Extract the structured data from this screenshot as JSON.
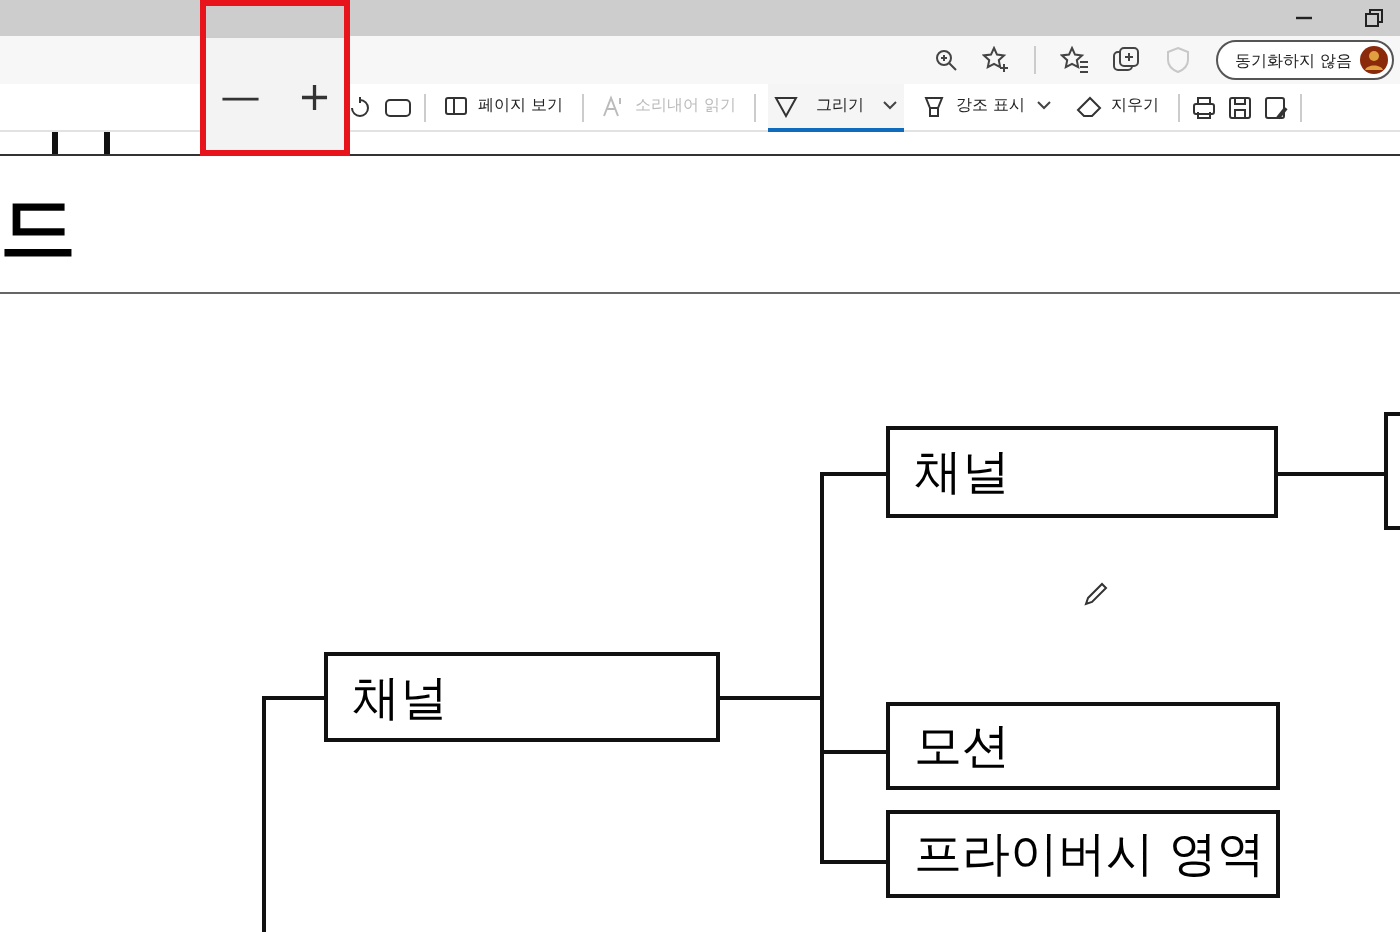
{
  "profile_button": {
    "label": "동기화하지 않음"
  },
  "zoom_flyout": {
    "buttons": [
      "—",
      "+"
    ]
  },
  "pdf_toolbar": {
    "tools": [
      {
        "label": "페이지 보기",
        "disabled": false,
        "selected": false,
        "dropdown": false
      },
      {
        "label": "소리내어 읽기",
        "disabled": true,
        "selected": false,
        "dropdown": false
      },
      {
        "label": "그리기",
        "disabled": false,
        "selected": true,
        "dropdown": true
      },
      {
        "label": "강조 표시",
        "disabled": false,
        "selected": false,
        "dropdown": true
      },
      {
        "label": "지우기",
        "disabled": false,
        "selected": false,
        "dropdown": false
      }
    ]
  },
  "document": {
    "heading": "드",
    "diagram": {
      "nodes": [
        {
          "label": "채널"
        },
        {
          "label": "채널"
        },
        {
          "label": "모션"
        },
        {
          "label": "프라이버시 영역"
        }
      ]
    }
  }
}
